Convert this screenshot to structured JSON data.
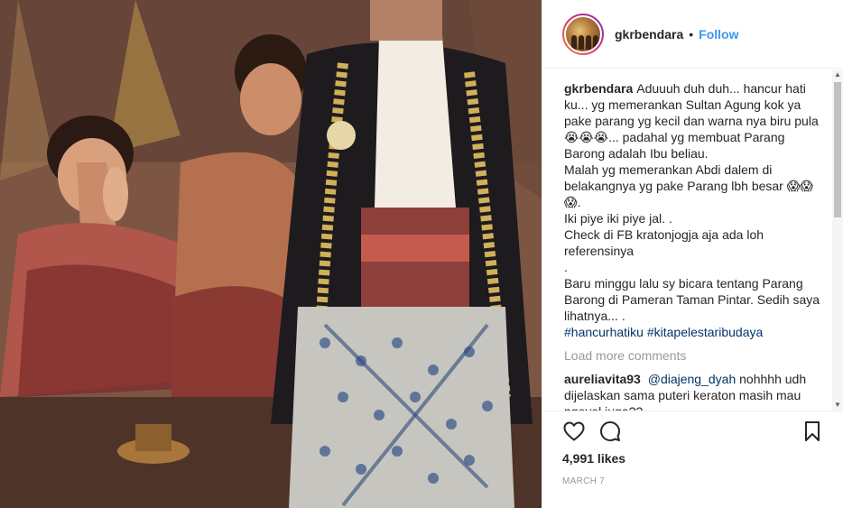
{
  "photo": {
    "description_icon": "photo-post-image"
  },
  "header": {
    "username": "gkrbendara",
    "separator": "•",
    "follow_label": "Follow"
  },
  "caption": {
    "username": "gkrbendara",
    "lines": [
      "Aduuuh duh duh... hancur hati ku... yg memerankan Sultan Agung kok ya pake parang yg kecil dan warna nya biru pula 😭😭😭... padahal yg membuat Parang Barong adalah Ibu beliau.",
      "Malah yg memerankan Abdi dalem di belakangnya yg pake Parang lbh besar 😱😱😱.",
      "Iki piye iki piye jal. .",
      "Check di FB kratonjogja aja ada loh referensinya",
      ".",
      "Baru minggu lalu sy bicara tentang Parang Barong di Pameran Taman Pintar. Sedih saya lihatnya... ."
    ],
    "hashtags": [
      "#hancurhatiku",
      "#kitapelestaribudaya"
    ]
  },
  "load_more_label": "Load more comments",
  "comment": {
    "username": "aureliavita93",
    "mention": "@diajeng_dyah",
    "text": "nohhhh udh dijelaskan sama puteri keraton masih mau ngeyel juga??"
  },
  "actions": {
    "like_icon": "heart-icon",
    "comment_icon": "comment-icon",
    "save_icon": "bookmark-icon"
  },
  "likes_text": "4,991 likes",
  "date_text": "MARCH 7",
  "colors": {
    "accent": "#3897f0",
    "hashtag": "#003569",
    "muted": "#999999",
    "text": "#262626"
  }
}
